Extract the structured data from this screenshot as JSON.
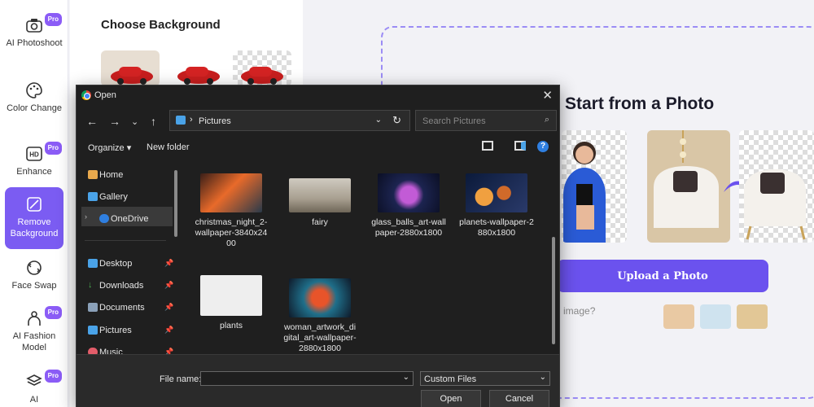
{
  "nav": {
    "items": [
      {
        "label": "AI Photoshoot",
        "pro": "Pro"
      },
      {
        "label": "Color Change",
        "pro": ""
      },
      {
        "label": "Enhance",
        "pro": "Pro"
      },
      {
        "label": "Remove Background",
        "pro": ""
      },
      {
        "label": "Face Swap",
        "pro": ""
      },
      {
        "label": "AI Fashion Model",
        "pro": "Pro"
      },
      {
        "label": "AI",
        "pro": "Pro"
      }
    ],
    "active_color": "#7b5cf2"
  },
  "bg_panel": {
    "title": "Choose Background"
  },
  "main": {
    "title": "Start from a Photo",
    "upload_label": "Upload a Photo",
    "hint": "n image?",
    "accent": "#6b52ee"
  },
  "dialog": {
    "title": "Open",
    "address": "Pictures",
    "search_placeholder": "Search Pictures",
    "organize": "Organize",
    "new_folder": "New folder",
    "nav_items": [
      "Home",
      "Gallery",
      "OneDrive",
      "Desktop",
      "Downloads",
      "Documents",
      "Pictures",
      "Music"
    ],
    "files": [
      {
        "name": "christmas_night_2-wallpaper-3840x2400"
      },
      {
        "name": "fairy"
      },
      {
        "name": "glass_balls_art-wallpaper-2880x1800"
      },
      {
        "name": "planets-wallpaper-2880x1800"
      },
      {
        "name": "plants"
      },
      {
        "name": "woman_artwork_digital_art-wallpaper-2880x1800"
      }
    ],
    "file_name_label": "File name:",
    "file_name_value": "",
    "file_type": "Custom Files",
    "open_label": "Open",
    "cancel_label": "Cancel"
  }
}
